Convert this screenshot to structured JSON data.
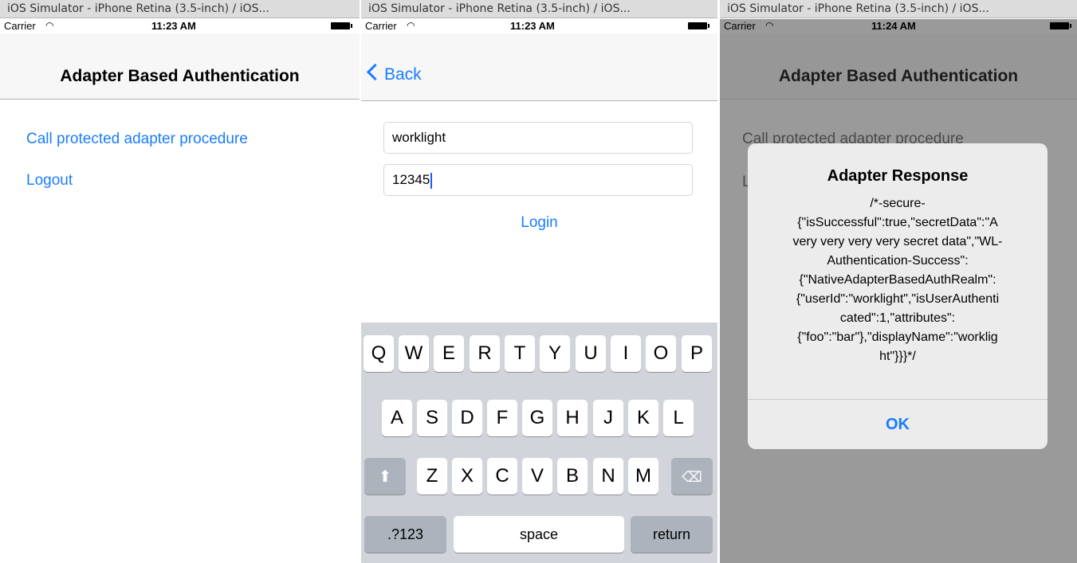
{
  "window_title": "iOS Simulator - iPhone Retina (3.5-inch) / iOS...",
  "status": {
    "carrier": "Carrier",
    "time1": "11:23 AM",
    "time2": "11:23 AM",
    "time3": "11:24 AM"
  },
  "screen1": {
    "title": "Adapter Based Authentication",
    "call_link": "Call protected adapter procedure",
    "logout_link": "Logout"
  },
  "screen2": {
    "back": "Back",
    "username": "worklight",
    "password": "12345",
    "login": "Login",
    "keyboard": {
      "row1": [
        "Q",
        "W",
        "E",
        "R",
        "T",
        "Y",
        "U",
        "I",
        "O",
        "P"
      ],
      "row2": [
        "A",
        "S",
        "D",
        "F",
        "G",
        "H",
        "J",
        "K",
        "L"
      ],
      "row3": [
        "Z",
        "X",
        "C",
        "V",
        "B",
        "N",
        "M"
      ],
      "numbers": ".?123",
      "space": "space",
      "return": "return"
    }
  },
  "screen3": {
    "title": "Adapter Based Authentication",
    "call_link_partial": "Call protected adapter procedure",
    "logout_partial": "L",
    "alert_title": "Adapter Response",
    "alert_message": "/*-secure-\n{\"isSuccessful\":true,\"secretData\":\"A very very very very secret data\",\"WL-Authentication-Success\":{\"NativeAdapterBasedAuthRealm\":{\"userId\":\"worklight\",\"isUserAuthenticated\":1,\"attributes\":{\"foo\":\"bar\"},\"displayName\":\"worklight\"}}}*/",
    "alert_lines": [
      "/*-secure-",
      "{\"isSuccessful\":true,\"secretData\":\"A",
      "very very very very secret data\",\"WL-",
      "Authentication-Success\":",
      "{\"NativeAdapterBasedAuthRealm\":",
      "{\"userId\":\"worklight\",\"isUserAuthenti",
      "cated\":1,\"attributes\":",
      "{\"foo\":\"bar\"},\"displayName\":\"worklig",
      "ht\"}}}*/"
    ],
    "ok": "OK"
  }
}
